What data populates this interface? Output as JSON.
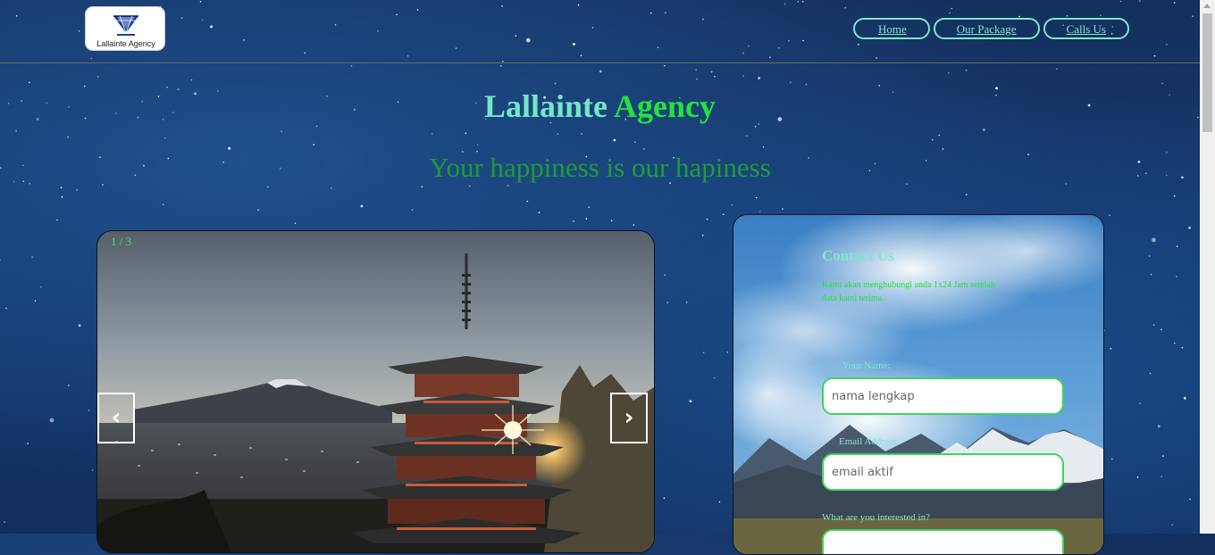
{
  "header": {
    "logo_text": "Lallainte Agency",
    "nav": [
      {
        "label": "Home"
      },
      {
        "label": "Our Package"
      },
      {
        "label": "Calls Us"
      }
    ]
  },
  "hero": {
    "title_part1": "Lallainte",
    "title_part2": "Agency",
    "tagline": "Your happiness is our hapiness"
  },
  "slideshow": {
    "counter": "1 / 3",
    "prev_label": "‹",
    "next_label": "›"
  },
  "contact": {
    "title": "Contact Us",
    "description": "Kami akan menghubungi anda 1x24 Jam setelah data kami terima.",
    "name_label": "Your Name:",
    "name_placeholder": "nama lengkap",
    "email_label": "Email Address:",
    "email_placeholder": "email aktif",
    "interest_label": "What are you interested in?"
  },
  "colors": {
    "accent_teal": "#7ee8c9",
    "accent_green": "#22e43c",
    "tagline_green": "#1e9c38",
    "field_border": "#3fd45c"
  },
  "icons": [
    "diamond-logo-icon",
    "chevron-left-icon",
    "chevron-right-icon"
  ]
}
